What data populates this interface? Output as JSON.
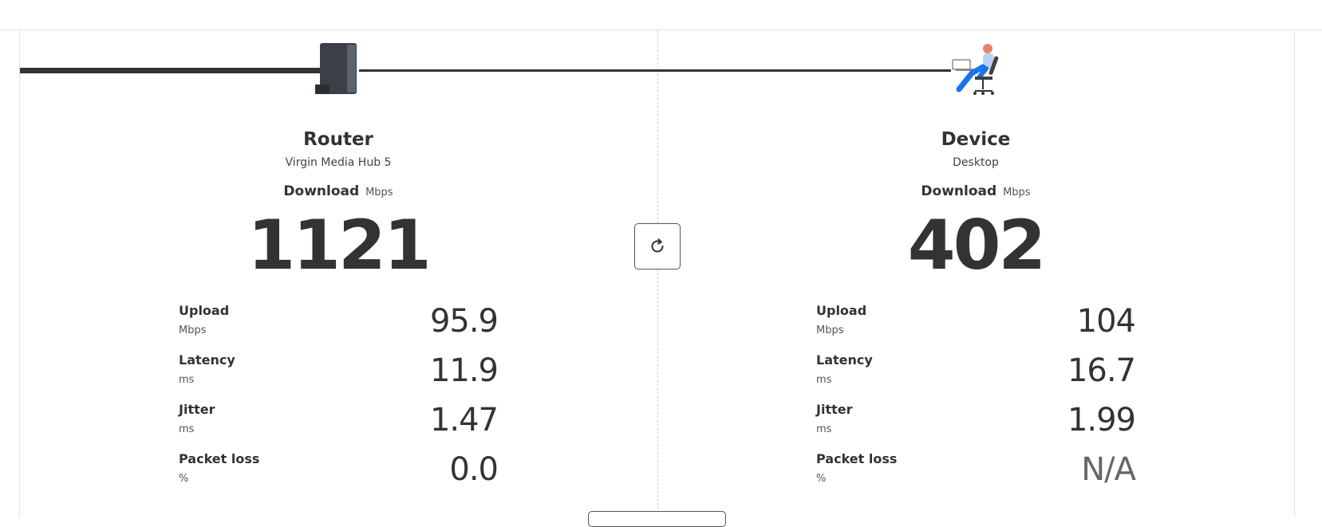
{
  "router": {
    "title": "Router",
    "subtitle": "Virgin Media Hub 5",
    "download_label": "Download",
    "download_unit": "Mbps",
    "download_value": "1121",
    "metrics": [
      {
        "label": "Upload",
        "unit": "Mbps",
        "value": "95.9"
      },
      {
        "label": "Latency",
        "unit": "ms",
        "value": "11.9"
      },
      {
        "label": "Jitter",
        "unit": "ms",
        "value": "1.47"
      },
      {
        "label": "Packet loss",
        "unit": "%",
        "value": "0.0"
      }
    ]
  },
  "device": {
    "title": "Device",
    "subtitle": "Desktop",
    "download_label": "Download",
    "download_unit": "Mbps",
    "download_value": "402",
    "metrics": [
      {
        "label": "Upload",
        "unit": "Mbps",
        "value": "104"
      },
      {
        "label": "Latency",
        "unit": "ms",
        "value": "16.7"
      },
      {
        "label": "Jitter",
        "unit": "ms",
        "value": "1.99"
      },
      {
        "label": "Packet loss",
        "unit": "%",
        "value": "N/A"
      }
    ]
  },
  "icons": {
    "router": "router-icon",
    "device": "person-at-desk-icon",
    "refresh": "refresh-icon"
  },
  "colors": {
    "text": "#333333",
    "line": "#333333",
    "divider": "#cfcfcf",
    "person_accent": "#1a73e8",
    "person_head": "#e8836e"
  }
}
